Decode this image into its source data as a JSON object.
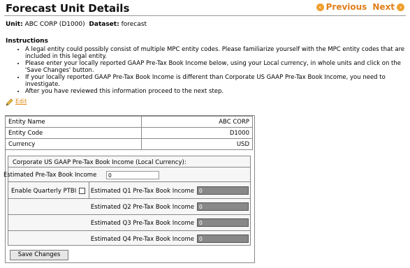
{
  "header": {
    "title": "Forecast Unit Details",
    "previous_label": "Previous",
    "next_label": "Next"
  },
  "unit": {
    "unit_label": "Unit:",
    "unit_value": "ABC CORP (D1000)",
    "dataset_label": "Dataset:",
    "dataset_value": "forecast"
  },
  "instructions": {
    "heading": "Instructions",
    "items": [
      "A legal entity could possibly consist of multiple MPC entity codes. Please familiarize yourself with the MPC entity codes that are included in this legal entity.",
      "Please enter your locally reported GAAP Pre-Tax Book Income below, using your Local currency, in whole units and click on the 'Save Changes' button.",
      "If your locally reported GAAP Pre-Tax Book Income is different than Corporate US GAAP Pre-Tax Book Income, you need to investigate.",
      "After you have reviewed this information proceed to the next step."
    ]
  },
  "edit_label": "Edit",
  "entity": {
    "rows": [
      {
        "label": "Entity Name",
        "value": "ABC CORP"
      },
      {
        "label": "Entity Code",
        "value": "D1000"
      },
      {
        "label": "Currency",
        "value": "USD"
      }
    ]
  },
  "income": {
    "title": "Corporate US GAAP Pre-Tax Book Income (Local Currency):",
    "estimated_label": "Estimated Pre-Tax Book Income",
    "estimated_value": "0",
    "enable_quarterly_label": "Enable Quarterly PTBI",
    "quarters": [
      {
        "label": "Estimated Q1 Pre-Tax Book Income",
        "value": "0"
      },
      {
        "label": "Estimated Q2 Pre-Tax Book Income",
        "value": "0"
      },
      {
        "label": "Estimated Q3 Pre-Tax Book Income",
        "value": "0"
      },
      {
        "label": "Estimated Q4 Pre-Tax Book Income",
        "value": "0"
      }
    ]
  },
  "save_label": "Save Changes",
  "colors": {
    "accent": "#e07f1a",
    "disabled_input": "#888888"
  }
}
